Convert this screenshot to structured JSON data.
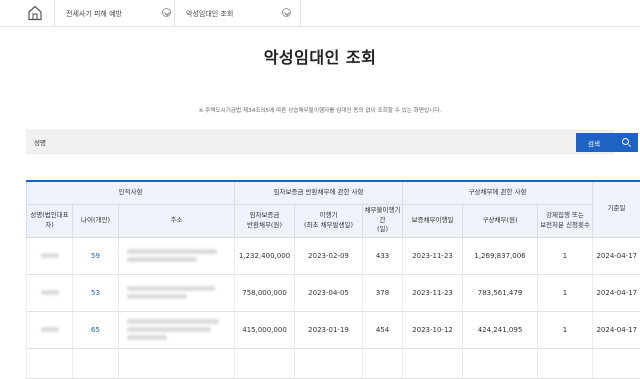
{
  "breadcrumb": {
    "section": "전세사기 피해 예방",
    "page": "악성임대인 조회"
  },
  "page_title": "악성임대인 조회",
  "notice": "※ 주택도시기금법 제34조의5에 따른 상습채무불이행자를 임대인 동의 없이 조회할 수 있는 화면입니다.",
  "search": {
    "label": "성명",
    "placeholder": "",
    "button_label": "검색"
  },
  "table": {
    "groups": {
      "personal": "인적사항",
      "deposit": "임차보증금 반환채무에 관한 사항",
      "indemnity": "구상채무에 관한 사항",
      "base_date": "기준일"
    },
    "columns": {
      "name": "성명(법인대표자)",
      "age": "나이(개인)",
      "address": "주소",
      "deposit_debt": "임차보증금\n반환채무(원)",
      "period": "이행기\n(최초 채무발생일)",
      "default_days": "채무불이행기간\n(일)",
      "indemnity_date": "보증채무이행일",
      "indemnity_debt": "구상채무(원)",
      "enforcement": "강제집행 또는\n보전처분 신청횟수"
    },
    "rows": [
      {
        "age": "59",
        "deposit_debt": "1,232,400,000",
        "period": "2023-02-09",
        "default_days": "433",
        "indemnity_date": "2023-11-23",
        "indemnity_debt": "1,269,837,006",
        "enforcement": "1",
        "base_date": "2024-04-17"
      },
      {
        "age": "53",
        "deposit_debt": "758,000,000",
        "period": "2023-04-05",
        "default_days": "378",
        "indemnity_date": "2023-11-23",
        "indemnity_debt": "783,561,479",
        "enforcement": "1",
        "base_date": "2024-04-17"
      },
      {
        "age": "65",
        "deposit_debt": "415,000,000",
        "period": "2023-01-19",
        "default_days": "454",
        "indemnity_date": "2023-10-12",
        "indemnity_debt": "424,241,095",
        "enforcement": "1",
        "base_date": "2024-04-17"
      }
    ]
  }
}
